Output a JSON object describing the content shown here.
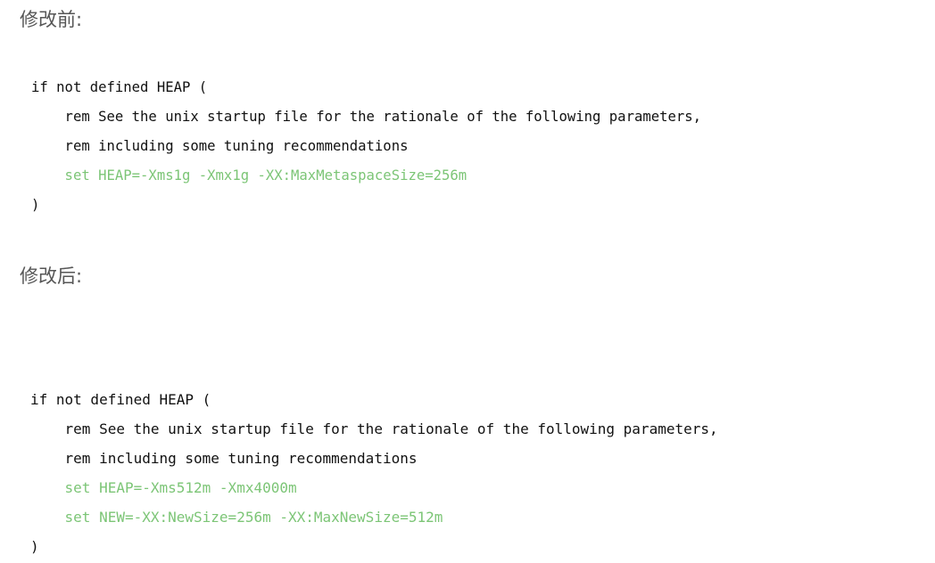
{
  "document": {
    "background_color": "#ffffff",
    "text_color": "#111111",
    "heading_color": "#565656",
    "accent_green": "#7cc576"
  },
  "sections": [
    {
      "id": "before",
      "heading": "修改前:",
      "code_lines": [
        {
          "text": "if not defined HEAP (",
          "color": "plain"
        },
        {
          "text": "    rem See the unix startup file for the rationale of the following parameters,",
          "color": "plain"
        },
        {
          "text": "    rem including some tuning recommendations",
          "color": "plain"
        },
        {
          "text": "    set HEAP=-Xms1g -Xmx1g -XX:MaxMetaspaceSize=256m",
          "color": "green"
        },
        {
          "text": ")",
          "color": "plain"
        }
      ]
    },
    {
      "id": "after",
      "heading": "修改后:",
      "code_lines": [
        {
          "text": "if not defined HEAP (",
          "color": "plain"
        },
        {
          "text": "    rem See the unix startup file for the rationale of the following parameters,",
          "color": "plain"
        },
        {
          "text": "    rem including some tuning recommendations",
          "color": "plain"
        },
        {
          "text": "    set HEAP=-Xms512m -Xmx4000m",
          "color": "green"
        },
        {
          "text": "    set NEW=-XX:NewSize=256m -XX:MaxNewSize=512m",
          "color": "green"
        },
        {
          "text": ")",
          "color": "plain"
        }
      ]
    }
  ]
}
